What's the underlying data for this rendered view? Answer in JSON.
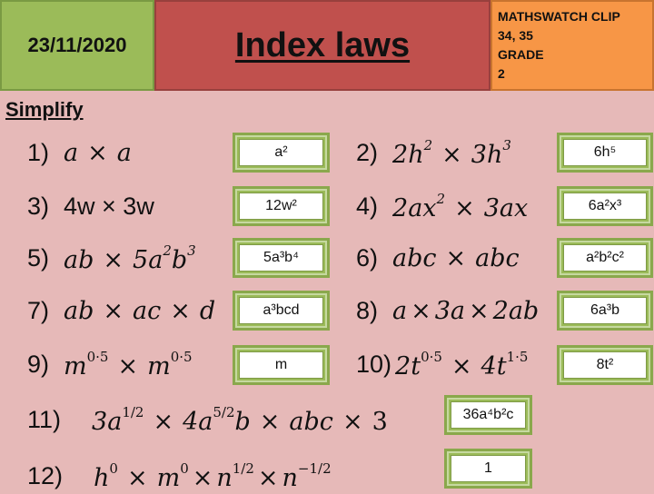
{
  "header": {
    "date": "23/11/2020",
    "title": "Index laws",
    "clip_lines": [
      "MATHSWATCH CLIP",
      "34, 35",
      "GRADE",
      "2"
    ]
  },
  "instruction": "Simplify",
  "questions": [
    {
      "number": "1)",
      "expression": "a × a",
      "answer": "a²"
    },
    {
      "number": "2)",
      "expression": "2h² × 3h³",
      "answer": "6h⁵"
    },
    {
      "number": "3)",
      "expression": "4w × 3w",
      "answer": "12w²"
    },
    {
      "number": "4)",
      "expression": "2ax² × 3ax",
      "answer": "6a²x³"
    },
    {
      "number": "5)",
      "expression": "ab × 5a²b³",
      "answer": "5a³b⁴"
    },
    {
      "number": "6)",
      "expression": "abc × abc",
      "answer": "a²b²c²"
    },
    {
      "number": "7)",
      "expression": "ab × ac × d",
      "answer": "a³bcd"
    },
    {
      "number": "8)",
      "expression": "a × 3a × 2ab",
      "answer": "6a³b"
    },
    {
      "number": "9)",
      "expression": "m^0·5 × m^0·5",
      "answer": "m"
    },
    {
      "number": "10)",
      "expression": "2t^0·5 × 4t^1·5",
      "answer": "8t²"
    },
    {
      "number": "11)",
      "expression": "3a^1/2 × 4a^5/2 b × abc × 3",
      "answer": "36a⁴b²c"
    },
    {
      "number": "12)",
      "expression": "h^0 × m^0 × n^1/2 × n^-1/2",
      "answer": "1"
    }
  ]
}
